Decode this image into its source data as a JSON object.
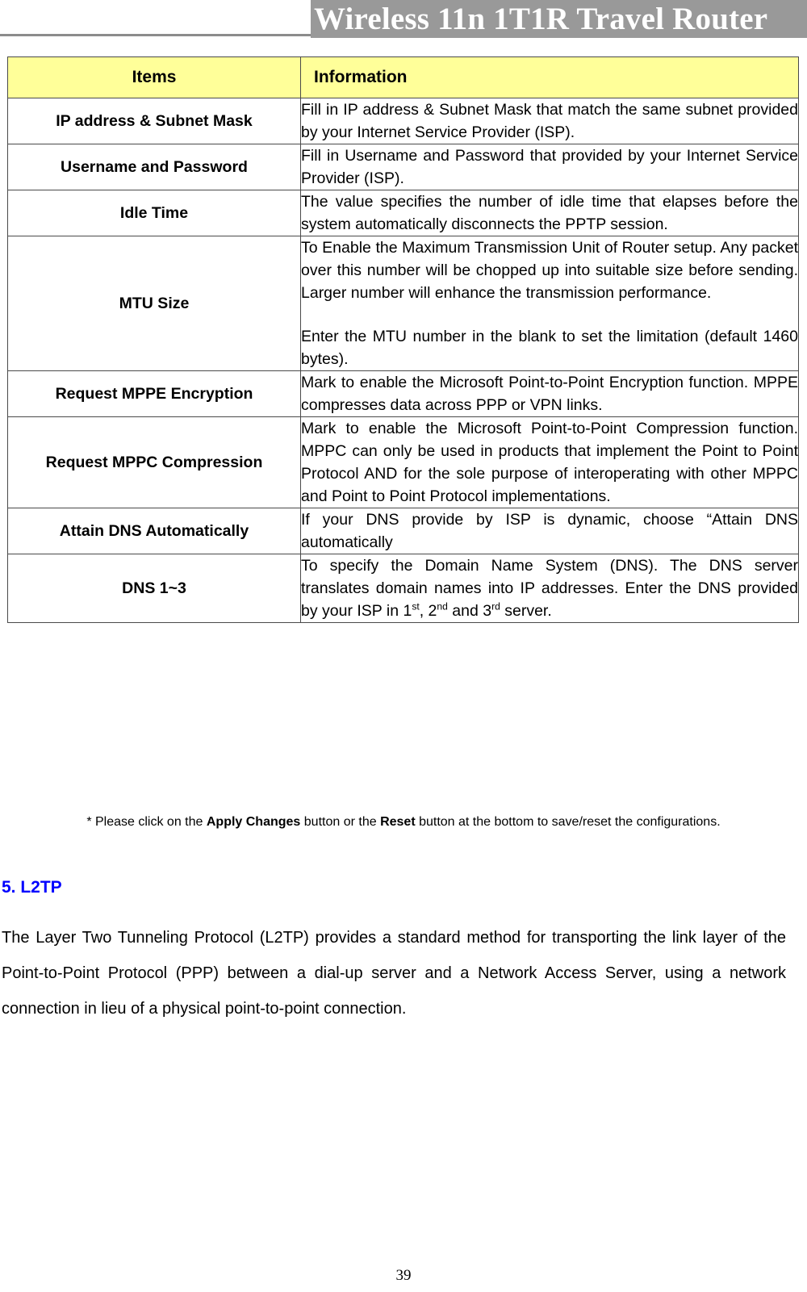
{
  "header": {
    "title": "Wireless 11n 1T1R Travel Router"
  },
  "table": {
    "columns": [
      "Items",
      "Information"
    ],
    "rows": [
      {
        "item": "IP address & Subnet Mask",
        "paragraphs": [
          "Fill in IP address & Subnet Mask that match the same subnet provided by your Internet Service Provider (ISP)."
        ]
      },
      {
        "item": "Username and Password",
        "paragraphs": [
          "Fill in Username and Password that provided by your Internet Service Provider (ISP)."
        ]
      },
      {
        "item": "Idle Time",
        "paragraphs": [
          "The value specifies the number of idle time that elapses before the system automatically disconnects the PPTP session."
        ]
      },
      {
        "item": "MTU Size",
        "paragraphs": [
          "To Enable the Maximum Transmission Unit of Router setup. Any packet over this number will be chopped up into suitable size before sending. Larger number will enhance the transmission performance.",
          "Enter the MTU number in the blank to set the limitation (default 1460 bytes)."
        ]
      },
      {
        "item": "Request MPPE Encryption",
        "paragraphs": [
          "Mark to enable the Microsoft Point-to-Point Encryption function. MPPE compresses data across PPP or VPN links."
        ]
      },
      {
        "item": "Request MPPC Compression",
        "paragraphs": [
          "Mark to enable the Microsoft Point-to-Point Compression function. MPPC can only be used in products that implement the Point to Point Protocol AND for the sole purpose of interoperating with other MPPC and Point to Point Protocol implementations."
        ]
      },
      {
        "item": "Attain DNS Automatically",
        "paragraphs": [
          "If your DNS provide by ISP is dynamic, choose “Attain DNS automatically"
        ]
      },
      {
        "item": "DNS 1~3",
        "paragraphs": [
          "To specify the Domain Name System (DNS). The DNS server translates domain names into IP addresses. Enter the DNS provided by your ISP in 1st, 2nd and 3rd server."
        ],
        "html_override": "To specify the Domain Name System (DNS). The DNS server translates domain names into IP addresses. Enter the DNS provided by your ISP in 1<sup>st</sup>, 2<sup>nd</sup> and 3<sup>rd</sup> server."
      }
    ]
  },
  "footnote": {
    "prefix": "* Please click on the ",
    "bold1": "Apply Changes",
    "mid": " button or the ",
    "bold2": "Reset",
    "suffix": " button at the bottom to save/reset the configurations."
  },
  "section": {
    "heading": "5. L2TP",
    "body": "The Layer Two Tunneling Protocol (L2TP) provides a standard method for transporting the link layer of the Point-to-Point Protocol (PPP) between a dial-up server and a Network Access Server, using a network connection in lieu of a physical point-to-point connection."
  },
  "page": {
    "number": "39"
  },
  "colors": {
    "header_banner": "#999999",
    "table_header_fill": "#ffff99",
    "section_heading": "#0000ff",
    "border": "#4a4a4a"
  }
}
